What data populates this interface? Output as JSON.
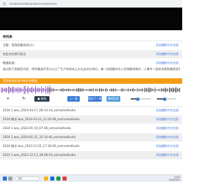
{
  "browser": {
    "url": "localhost/edit/audios/review/home"
  },
  "section": {
    "title": "待列表"
  },
  "rows": [
    {
      "text": "主题：音频质量测试(小)",
      "link": "添加播报中文信息"
    },
    {
      "text": "在此对应进行标注",
      "link": "添加播报中文信息"
    },
    {
      "text": "数据处理...",
      "link": "添加播报中文信息"
    }
  ],
  "description": "请对照下面播音内容，得到播放声音与从工厂生产的样本上方左右的分辨位，做一些提醒实时入音频翻译操作，小事件一起样本提取播报音频是否提示进行 ",
  "alert": {
    "text": "音频处理出现中断补充数据"
  },
  "controls": {
    "play": "⏸",
    "replay": "↻",
    "btn_mark": "● 结标",
    "btn_prev": "上一条",
    "btn_next": "保存下一条",
    "btn_delete": "删除此条",
    "volume_level": 0.35,
    "speed_level": 0.4
  },
  "files": [
    {
      "text": "2024  1  wav_2024-03-17_08-14-14_extractedAudio",
      "link": "添加播报中文信息"
    },
    {
      "text": "2024  微试  wav_2024-03-21_12-42-08_extractedAudio",
      "link": "添加播报中文信息"
    },
    {
      "text": "2024  1  wav_2024-01-19_07-08_extractedAudio",
      "link": "添加播报中文信息"
    },
    {
      "text": "2024  1  wav_2024-01-21_15-14-40_extractedAudio",
      "link": "添加播报中文信息"
    },
    {
      "text": "2024  微试  wav_2023-12-25_17-28-09_extractedAudio",
      "link": "添加播报中文信息"
    },
    {
      "text": "2023  1  wav_2023-12-13_18-48-10_extractedAudio",
      "link": "添加播报中文信息"
    }
  ],
  "taskbar": {
    "search": "搜索",
    "time": "14:22",
    "date": "2024/3/21"
  },
  "colors": {
    "accent": "#3a7bd5",
    "alert": "#f39c12",
    "wave_played": "#7a3fb0",
    "wave_rest": "#3a3a3a"
  }
}
